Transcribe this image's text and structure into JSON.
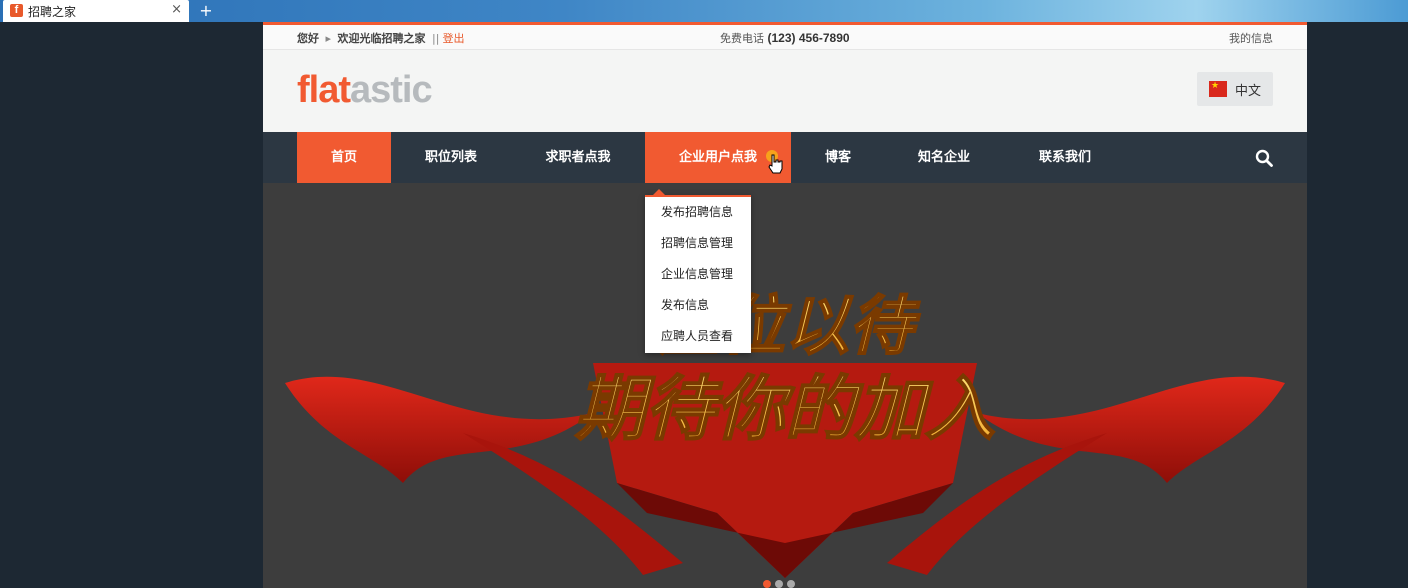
{
  "browser": {
    "tab_title": "招聘之家",
    "tab_favicon": "f",
    "close_glyph": "×",
    "newtab_glyph": "+"
  },
  "topbar": {
    "greeting": "您好",
    "arrow": "▸",
    "welcome": "欢迎光临招聘之家",
    "separator": "||",
    "logout": "登出",
    "phone_label": "免费电话",
    "phone": "(123) 456-7890",
    "my_info": "我的信息"
  },
  "header": {
    "logo_part1": "flat",
    "logo_part2": "astic",
    "language": "中文"
  },
  "nav": {
    "items": [
      {
        "label": "首页"
      },
      {
        "label": "职位列表"
      },
      {
        "label": "求职者点我"
      },
      {
        "label": "企业用户点我"
      },
      {
        "label": "博客"
      },
      {
        "label": "知名企业"
      },
      {
        "label": "联系我们"
      }
    ]
  },
  "dropdown": {
    "items": [
      {
        "label": "发布招聘信息"
      },
      {
        "label": "招聘信息管理"
      },
      {
        "label": "企业信息管理"
      },
      {
        "label": "发布信息"
      },
      {
        "label": "应聘人员查看"
      }
    ]
  },
  "banner": {
    "line1": "虚位以待",
    "line2": "期待你的加入"
  },
  "colors": {
    "accent": "#f15a31",
    "nav_bg": "#2c3742",
    "banner_text": "#f7c640"
  },
  "icons": [
    "search-icon",
    "china-flag-icon",
    "hand-cursor-icon",
    "close-icon",
    "plus-icon"
  ]
}
